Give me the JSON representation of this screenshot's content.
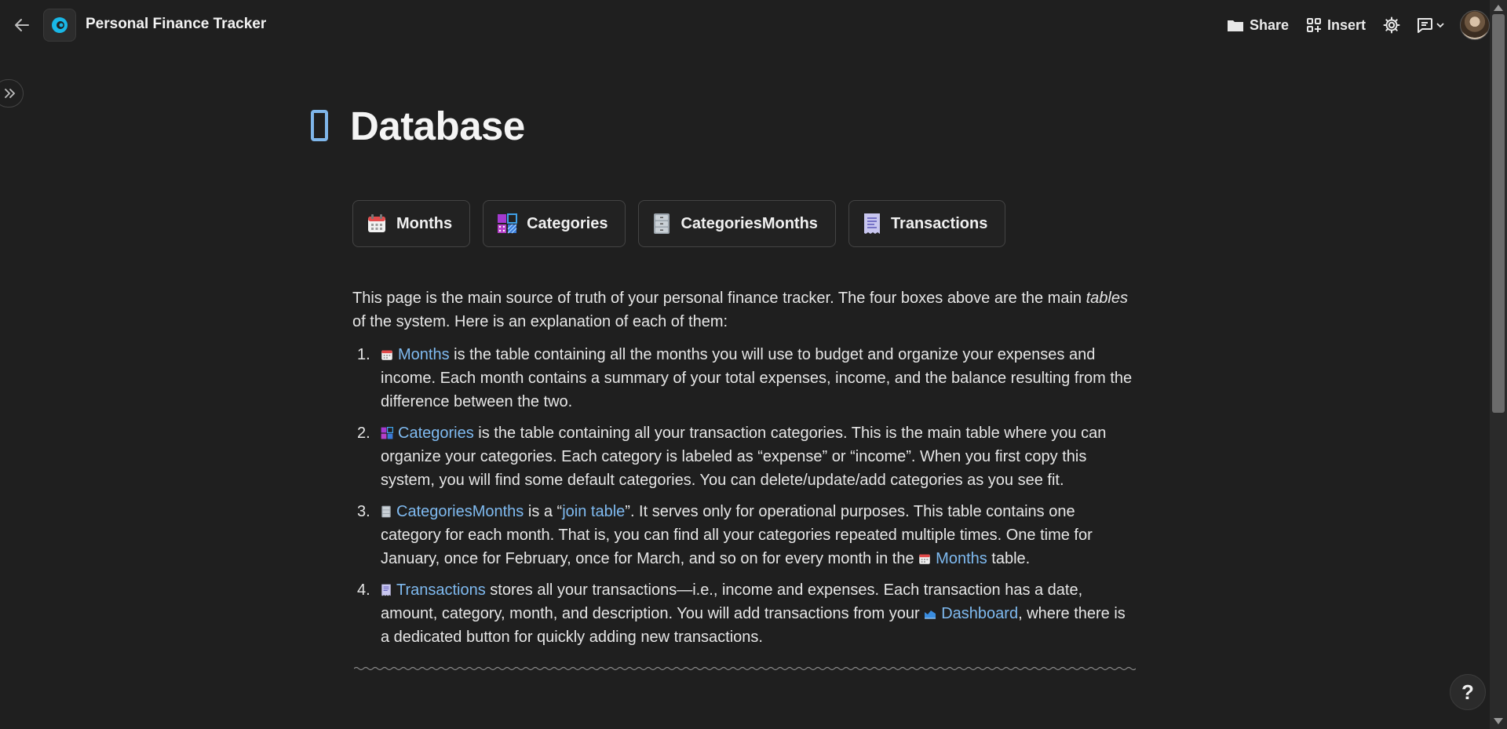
{
  "header": {
    "title": "Personal Finance Tracker",
    "share_label": "Share",
    "insert_label": "Insert"
  },
  "page": {
    "title": "Database"
  },
  "boxes": [
    {
      "label": "Months",
      "icon": "calendar-icon"
    },
    {
      "label": "Categories",
      "icon": "categories-icon"
    },
    {
      "label": "CategoriesMonths",
      "icon": "cabinet-icon"
    },
    {
      "label": "Transactions",
      "icon": "receipt-icon"
    }
  ],
  "intro": {
    "part1": "This page is the main source of truth of your personal finance tracker. The four boxes above are the main ",
    "italic": "tables",
    "part2": " of the system. Here is an explanation of each of them:"
  },
  "items": [
    {
      "num": "1.",
      "link": "Months",
      "text": " is the table containing all the months you will use to budget and organize your expenses and income. Each month contains a summary of your total expenses, income, and the balance resulting from the difference between the two."
    },
    {
      "num": "2.",
      "link": "Categories",
      "text": " is the table containing all your transaction categories. This is the main table where you can organize your categories. Each category is labeled as “expense” or “income”. When you first copy this system, you will find some default categories. You can delete/update/add categories as you see fit."
    },
    {
      "num": "3.",
      "link": "CategoriesMonths",
      "text_a": " is a “",
      "link2": "join table",
      "text_b": "”. It serves only for operational purposes. This table contains one category for each month. That is, you can find all your categories repeated multiple times. One time for January, once for February, once for March, and so on for every month in the ",
      "link3": "Months",
      "text_c": " table."
    },
    {
      "num": "4.",
      "link": "Transactions",
      "text_a": " stores all your transactions—i.e., income and expenses. Each transaction has a date, amount, category, month, and description. You will add transactions from your ",
      "link2": "Dashboard",
      "text_b": ", where there is a dedicated button for quickly adding new transactions."
    }
  ],
  "help": {
    "label": "?"
  },
  "colors": {
    "background": "#1f1f1f",
    "link": "#7fbaf0",
    "accent_icon": "#7fb6ea"
  }
}
